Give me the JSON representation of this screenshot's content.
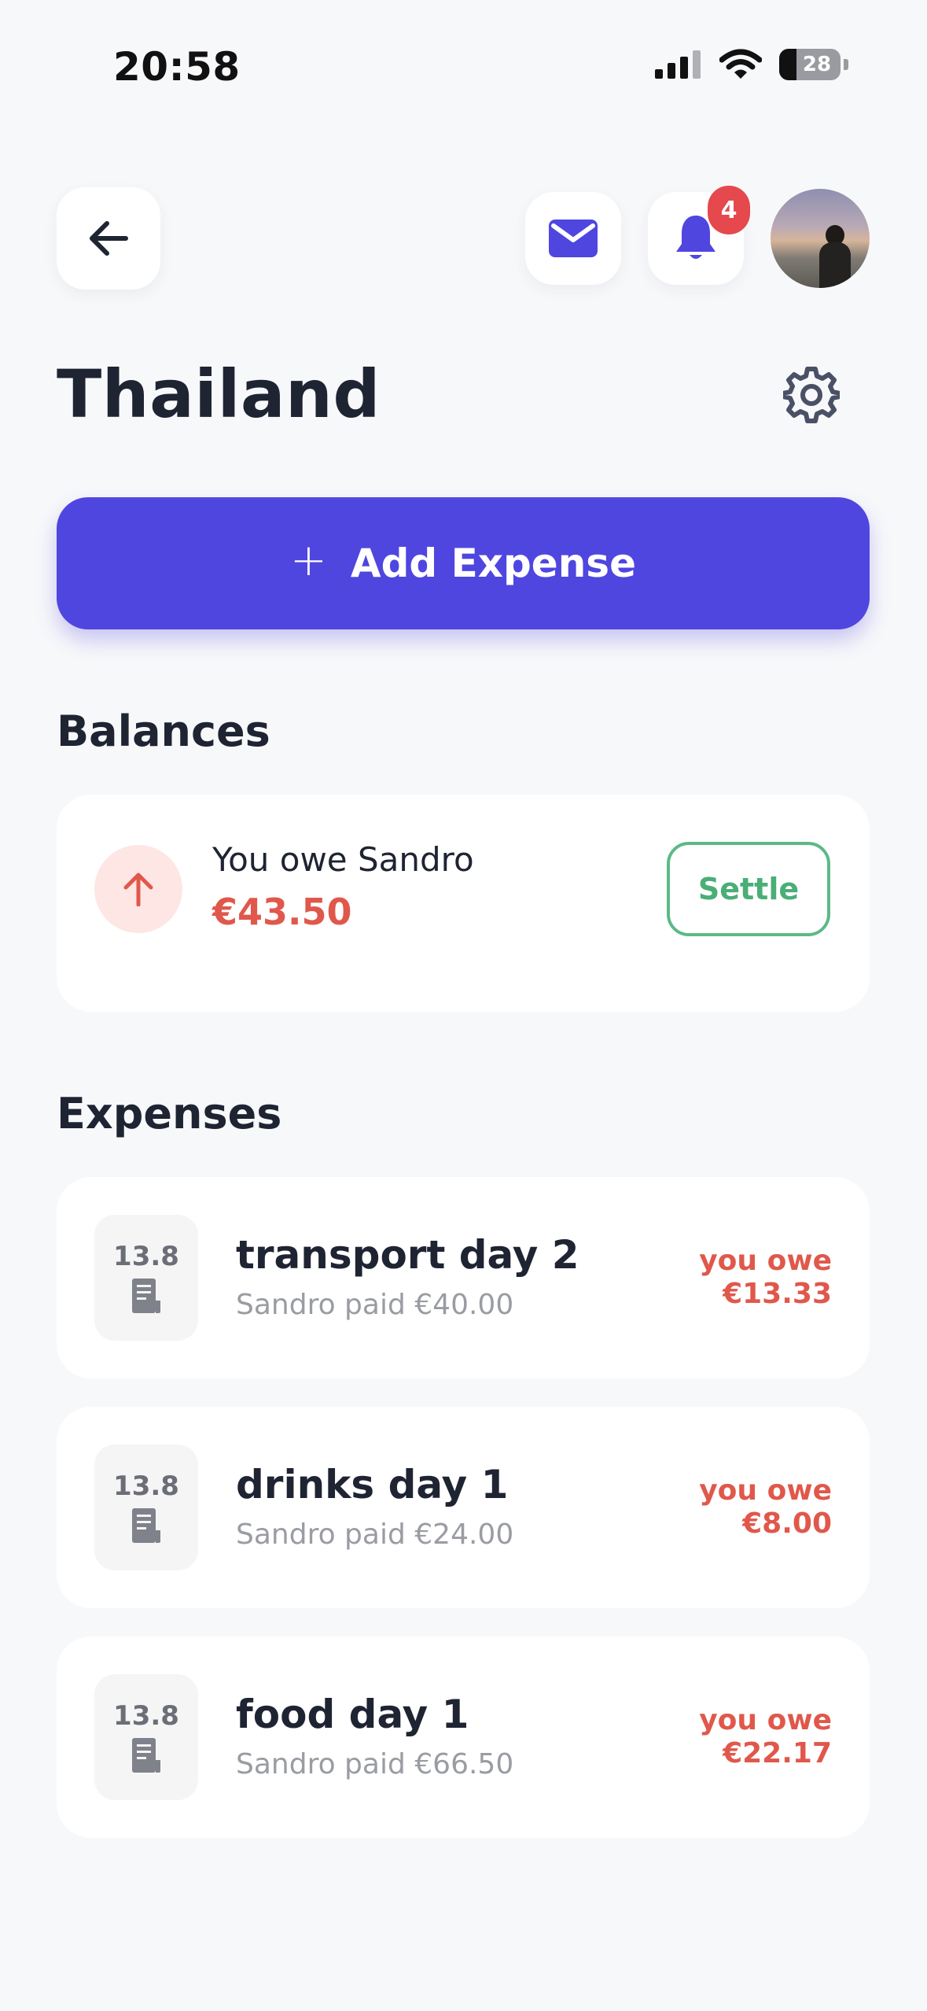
{
  "status_bar": {
    "time": "20:58",
    "battery": "28"
  },
  "header": {
    "notification_count": "4"
  },
  "page": {
    "title": "Thailand"
  },
  "actions": {
    "add_expense_label": "Add Expense",
    "add_icon": "+"
  },
  "balances": {
    "title": "Balances",
    "items": [
      {
        "text": "You owe Sandro",
        "amount": "€43.50",
        "action": "Settle"
      }
    ]
  },
  "expenses": {
    "title": "Expenses",
    "items": [
      {
        "date": "13.8",
        "title": "transport day 2",
        "subtitle": "Sandro paid €40.00",
        "owe_label": "you owe",
        "owe_amount": "€13.33"
      },
      {
        "date": "13.8",
        "title": "drinks day 1",
        "subtitle": "Sandro paid €24.00",
        "owe_label": "you owe",
        "owe_amount": "€8.00"
      },
      {
        "date": "13.8",
        "title": "food day 1",
        "subtitle": "Sandro paid €66.50",
        "owe_label": "you owe",
        "owe_amount": "€22.17"
      }
    ]
  },
  "colors": {
    "accent": "#4f46e0",
    "owe": "#e0584b",
    "settle": "#4aae77",
    "badge": "#e5484d"
  }
}
